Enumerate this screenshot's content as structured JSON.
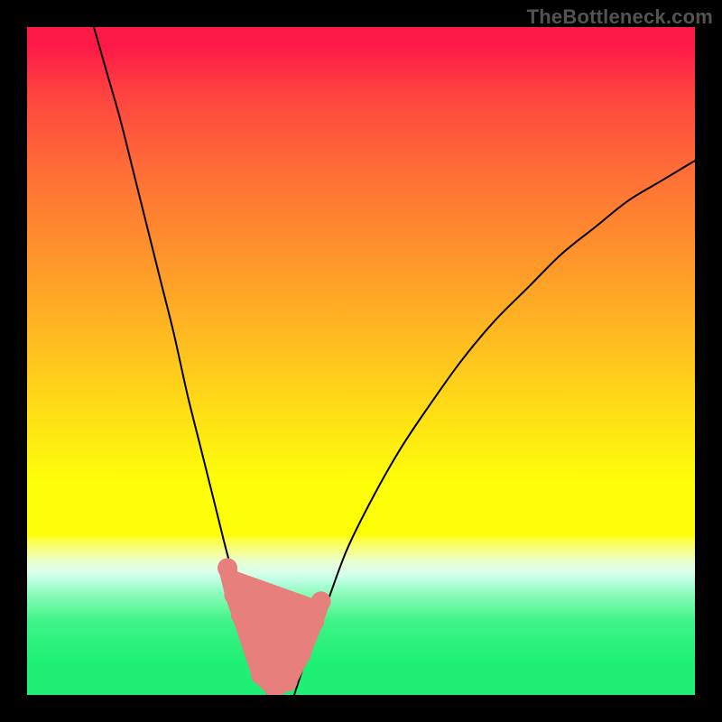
{
  "watermark": "TheBottleneck.com",
  "colors": {
    "frame": "#000000",
    "gradient_top": "#fe1a48",
    "gradient_mid": "#fefe09",
    "gradient_bottom": "#1ef075",
    "curve": "#000000",
    "marker": "#e77f7c"
  },
  "chart_data": {
    "type": "line",
    "title": "",
    "xlabel": "",
    "ylabel": "",
    "xlim": [
      0,
      100
    ],
    "ylim": [
      0,
      100
    ],
    "series": [
      {
        "name": "left-curve",
        "x": [
          10,
          12,
          14,
          16,
          18,
          20,
          22,
          24,
          26,
          28,
          30,
          32,
          34,
          35,
          36
        ],
        "y": [
          100,
          93,
          86,
          78,
          70,
          62,
          54,
          45,
          37,
          29,
          21,
          14,
          7,
          3,
          0
        ]
      },
      {
        "name": "right-curve",
        "x": [
          40,
          42,
          45,
          48,
          52,
          56,
          60,
          65,
          70,
          75,
          80,
          85,
          90,
          95,
          100
        ],
        "y": [
          0,
          6,
          14,
          22,
          30,
          37,
          43,
          50,
          56,
          61,
          66,
          70,
          74,
          77,
          80
        ]
      }
    ],
    "markers": {
      "name": "highlight-region",
      "color": "#e77f7c",
      "points": [
        {
          "x": 30,
          "y": 19
        },
        {
          "x": 31,
          "y": 15
        },
        {
          "x": 32,
          "y": 12
        },
        {
          "x": 35,
          "y": 3
        },
        {
          "x": 37,
          "y": 1
        },
        {
          "x": 39,
          "y": 2
        },
        {
          "x": 41,
          "y": 6
        },
        {
          "x": 43,
          "y": 11
        },
        {
          "x": 44,
          "y": 14
        }
      ]
    },
    "legend": null,
    "grid": false
  }
}
